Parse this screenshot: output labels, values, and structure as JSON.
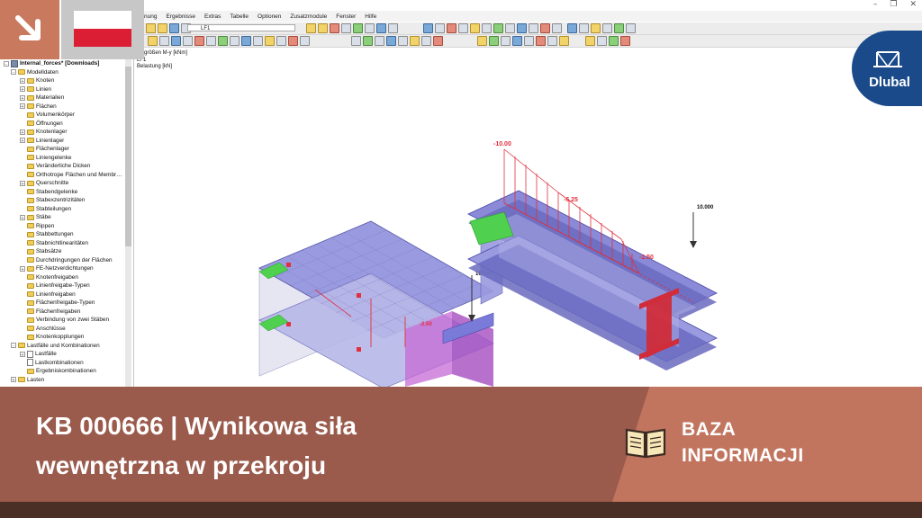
{
  "window": {
    "controls": [
      "–",
      "❐",
      "✕"
    ]
  },
  "menu": [
    "nung",
    "Ergebnisse",
    "Extras",
    "Tabelle",
    "Optionen",
    "Zusatzmodule",
    "Fenster",
    "Hilfe"
  ],
  "toolbar": {
    "loadcase_value": "LF1"
  },
  "navigator": {
    "root": "Internal_forces* [Downloads]",
    "items": [
      {
        "label": "Modelldaten",
        "level": 1,
        "expander": "-"
      },
      {
        "label": "Knoten",
        "level": 2,
        "expander": "+"
      },
      {
        "label": "Linien",
        "level": 2,
        "expander": "+"
      },
      {
        "label": "Materialien",
        "level": 2,
        "expander": "+"
      },
      {
        "label": "Flächen",
        "level": 2,
        "expander": "+"
      },
      {
        "label": "Volumenkörper",
        "level": 2,
        "expander": ""
      },
      {
        "label": "Öffnungen",
        "level": 2,
        "expander": ""
      },
      {
        "label": "Knotenlager",
        "level": 2,
        "expander": "+"
      },
      {
        "label": "Linienlager",
        "level": 2,
        "expander": "+"
      },
      {
        "label": "Flächenlager",
        "level": 2,
        "expander": ""
      },
      {
        "label": "Liniengelenke",
        "level": 2,
        "expander": ""
      },
      {
        "label": "Veränderliche Dicken",
        "level": 2,
        "expander": ""
      },
      {
        "label": "Orthotrope Flächen und Membr…",
        "level": 2,
        "expander": ""
      },
      {
        "label": "Querschnitte",
        "level": 2,
        "expander": "+"
      },
      {
        "label": "Stabendgelenke",
        "level": 2,
        "expander": ""
      },
      {
        "label": "Stabexzentrizitäten",
        "level": 2,
        "expander": ""
      },
      {
        "label": "Stabteilungen",
        "level": 2,
        "expander": ""
      },
      {
        "label": "Stäbe",
        "level": 2,
        "expander": "+"
      },
      {
        "label": "Rippen",
        "level": 2,
        "expander": ""
      },
      {
        "label": "Stabbettungen",
        "level": 2,
        "expander": ""
      },
      {
        "label": "Stabnichtlinearitäten",
        "level": 2,
        "expander": ""
      },
      {
        "label": "Stabsätze",
        "level": 2,
        "expander": ""
      },
      {
        "label": "Durchdringungen der Flächen",
        "level": 2,
        "expander": ""
      },
      {
        "label": "FE-Netzverdichtungen",
        "level": 2,
        "expander": "+"
      },
      {
        "label": "Knotenfreigaben",
        "level": 2,
        "expander": ""
      },
      {
        "label": "Linienfreigabe-Typen",
        "level": 2,
        "expander": ""
      },
      {
        "label": "Linienfreigaben",
        "level": 2,
        "expander": ""
      },
      {
        "label": "Flächenfreigabe-Typen",
        "level": 2,
        "expander": ""
      },
      {
        "label": "Flächenfreigaben",
        "level": 2,
        "expander": ""
      },
      {
        "label": "Verbindung von zwei Stäben",
        "level": 2,
        "expander": ""
      },
      {
        "label": "Anschlüsse",
        "level": 2,
        "expander": ""
      },
      {
        "label": "Knotenkopplungen",
        "level": 2,
        "expander": ""
      },
      {
        "label": "Lastfälle und Kombinationen",
        "level": 1,
        "expander": "-"
      },
      {
        "label": "Lastfälle",
        "level": 2,
        "expander": "+"
      },
      {
        "label": "Lastkombinationen",
        "level": 2,
        "expander": ""
      },
      {
        "label": "Ergebniskombinationen",
        "level": 2,
        "expander": ""
      },
      {
        "label": "Lasten",
        "level": 1,
        "expander": "+"
      }
    ]
  },
  "canvas": {
    "info_lines": [
      "nittgrößen M-y [kNm]",
      "LF1",
      "Belastung [kN]"
    ],
    "values": {
      "moment_start": "-10.00",
      "moment_mid": "-6.25",
      "moment_end": "-2.50",
      "moment_left": "-2.50",
      "load_right": "10.000",
      "load_left": "10.000"
    }
  },
  "logo": {
    "text": "Dlubal"
  },
  "banner": {
    "title_line1": "KB 000666 | Wynikowa siła",
    "title_line2": "wewnętrzna w przekroju",
    "category_line1": "BAZA",
    "category_line2": "INFORMACJI"
  },
  "colors": {
    "banner_dark": "#9a5a4c",
    "banner_light": "#c1755f",
    "flag_red": "#dc1e35",
    "dlubal_blue": "#1a4a8a",
    "beam_fill": "#8a8ad8",
    "diagram_red": "#e0303e",
    "support_green": "#4fd04f"
  },
  "icons": [
    "arrow-down-right-icon",
    "book-icon",
    "dlubal-bridge-icon"
  ]
}
